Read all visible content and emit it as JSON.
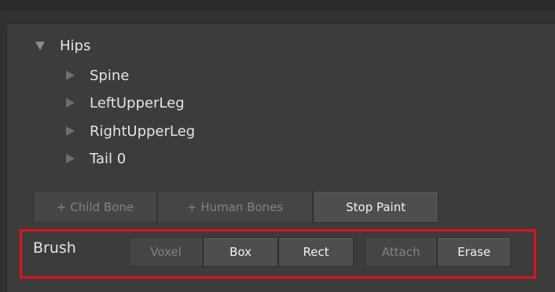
{
  "tree": {
    "root": {
      "label": "Hips",
      "expanded": true,
      "icon": "triangle-down-icon"
    },
    "children": [
      {
        "label": "Spine",
        "icon": "triangle-right-icon"
      },
      {
        "label": "LeftUpperLeg",
        "icon": "triangle-right-icon"
      },
      {
        "label": "RightUpperLeg",
        "icon": "triangle-right-icon"
      },
      {
        "label": "Tail 0",
        "icon": "triangle-right-icon"
      }
    ]
  },
  "toolbar": {
    "child_bone_label": "+ Child Bone",
    "human_bones_label": "+ Human Bones",
    "stop_paint_label": "Stop Paint"
  },
  "brush": {
    "label": "Brush",
    "shape_options": [
      {
        "label": "Voxel",
        "state": "dim"
      },
      {
        "label": "Box",
        "state": "active"
      },
      {
        "label": "Rect",
        "state": "active"
      }
    ],
    "mode_options": [
      {
        "label": "Attach",
        "state": "dim"
      },
      {
        "label": "Erase",
        "state": "active"
      }
    ],
    "highlight_color": "#e5101a"
  }
}
